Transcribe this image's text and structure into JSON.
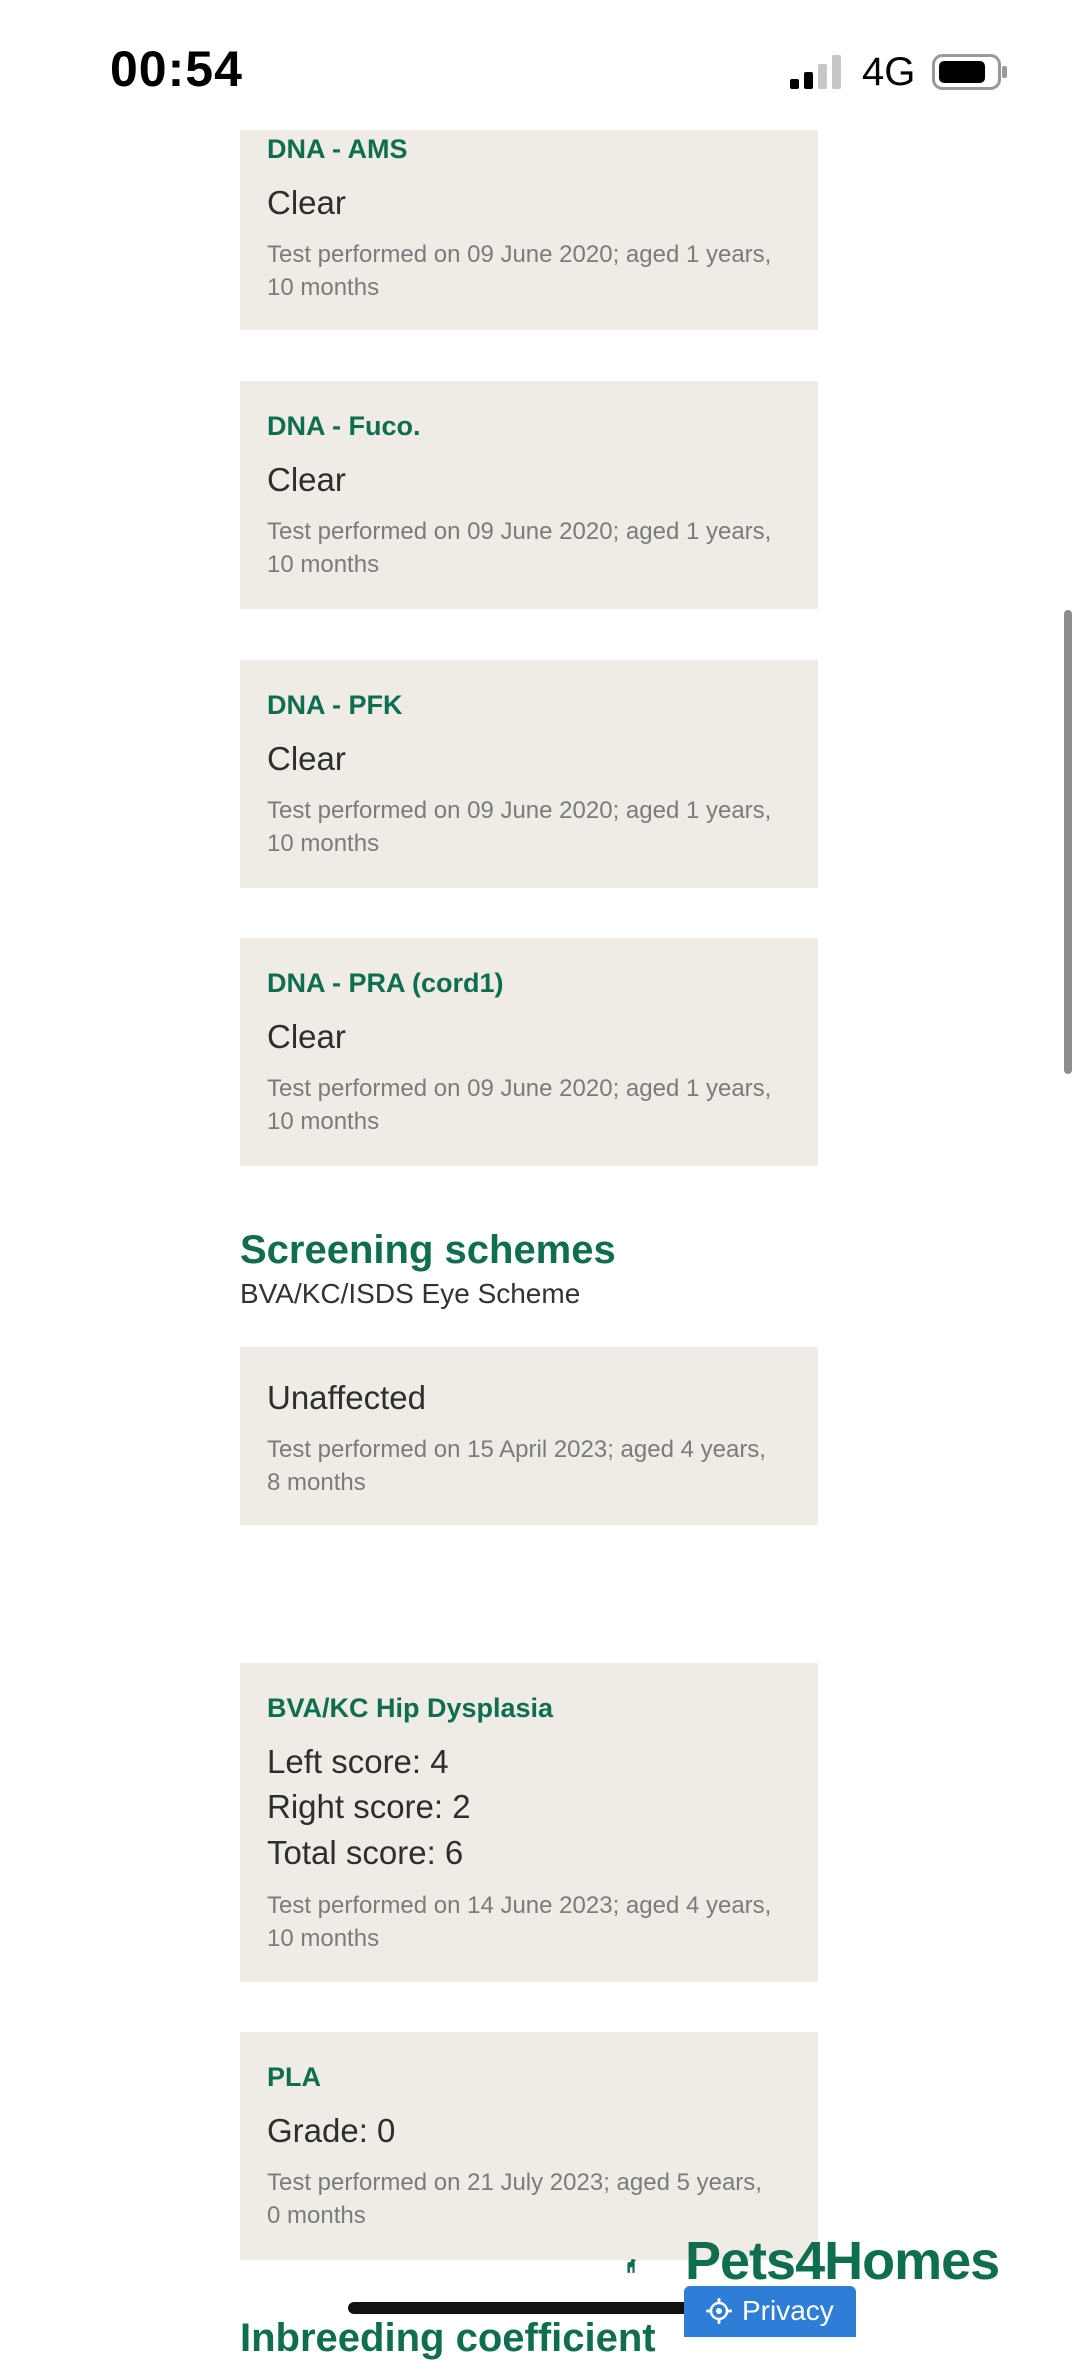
{
  "status_bar": {
    "time": "00:54",
    "network": "4G"
  },
  "dna_tests": [
    {
      "title": "DNA - AMS",
      "result": "Clear",
      "meta": "Test performed on 09 June 2020; aged 1 years, 10 months"
    },
    {
      "title": "DNA - Fuco.",
      "result": "Clear",
      "meta": "Test performed on 09 June 2020; aged 1 years, 10 months"
    },
    {
      "title": "DNA - PFK",
      "result": "Clear",
      "meta": "Test performed on 09 June 2020; aged 1 years, 10 months"
    },
    {
      "title": "DNA - PRA (cord1)",
      "result": "Clear",
      "meta": "Test performed on 09 June 2020; aged 1 years, 10 months"
    }
  ],
  "screening": {
    "title": "Screening schemes",
    "subtitle": "BVA/KC/ISDS Eye Scheme",
    "eye": {
      "result": "Unaffected",
      "meta": "Test performed on 15 April 2023; aged 4 years, 8 months"
    },
    "hip": {
      "title": "BVA/KC Hip Dysplasia",
      "left": "Left score: 4",
      "right": "Right score: 2",
      "total": "Total score: 6",
      "meta": "Test performed on 14 June 2023; aged 4 years, 10 months"
    },
    "pla": {
      "title": "PLA",
      "result": "Grade: 0",
      "meta": "Test performed on 21 July 2023; aged 5 years, 0 months"
    }
  },
  "partial_heading": "Inbreeding coefficient",
  "logo_text": "Pets4Homes",
  "privacy_label": "Privacy",
  "colors": {
    "accent": "#0e6e4f",
    "card_bg": "#efece6",
    "privacy_bg": "#2e7dd7"
  }
}
